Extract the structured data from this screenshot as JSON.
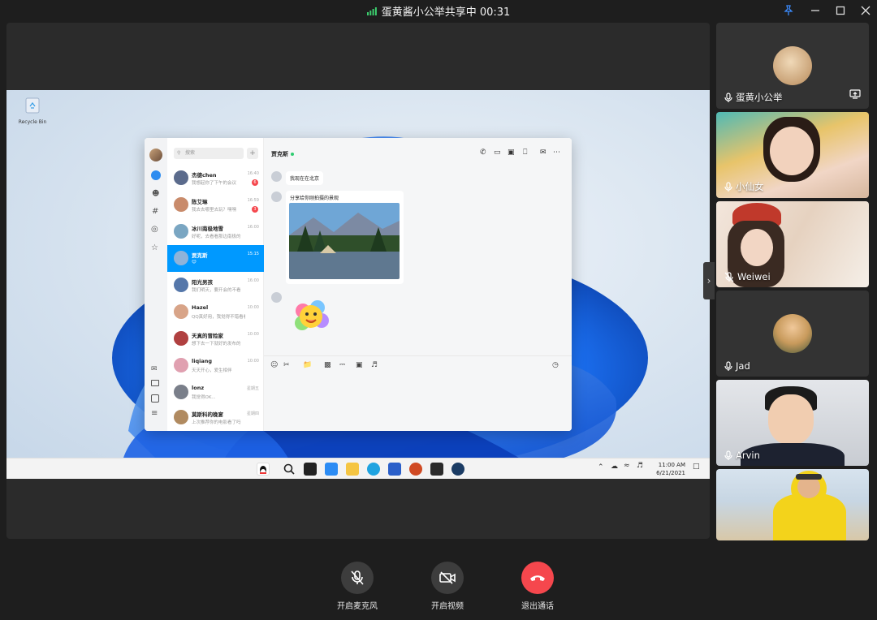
{
  "window": {
    "title": "蛋黄酱小公举共享中 00:31",
    "pin_icon": "pin-icon",
    "minimize_icon": "minimize-icon",
    "maximize_icon": "maximize-icon",
    "close_icon": "close-icon"
  },
  "shared_screen": {
    "desktop": {
      "recycle_bin_label": "Recycle Bin",
      "clock_time": "11:00 AM",
      "clock_date": "6/21/2021"
    },
    "qq": {
      "search_placeholder": "搜索",
      "add_label": "+",
      "conversations": [
        {
          "name": "杰德chen",
          "preview": "我想起你了下午的会议",
          "time": "16:40",
          "badge": "6",
          "color": "#5b6b8c"
        },
        {
          "name": "陈艾琳",
          "preview": "我去去哪里去玩？嘿嘿",
          "time": "16:59",
          "badge": "3",
          "color": "#c98b6b"
        },
        {
          "name": "冰川南极地雪",
          "preview": "好呢，去看看那边南极的",
          "time": "16:00",
          "badge": "",
          "color": "#7aa6c2"
        },
        {
          "name": "贾克斯",
          "preview": "😊",
          "time": "15:15",
          "badge": "",
          "color": "#8fb3d9"
        },
        {
          "name": "阳光男孩",
          "preview": "我们明天，要开会的不看",
          "time": "16:00",
          "badge": "",
          "color": "#5577aa"
        },
        {
          "name": "Hazel",
          "preview": "QQ真好用，我觉得不错看看",
          "time": "10:00",
          "badge": "",
          "color": "#d8a488"
        },
        {
          "name": "天真的冒险家",
          "preview": "想下去一下就好的发布的",
          "time": "10:00",
          "badge": "",
          "color": "#b04040"
        },
        {
          "name": "liqiang",
          "preview": "天天开心，爱生相伴",
          "time": "10:00",
          "badge": "",
          "color": "#e0a0b0"
        },
        {
          "name": "lonz",
          "preview": "我觉得OK...",
          "time": "星期五",
          "badge": "",
          "color": "#7a7f8a"
        },
        {
          "name": "莫斯科的晚宴",
          "preview": "上次推荐你的电影看了吗",
          "time": "星期四",
          "badge": "",
          "color": "#b08a60"
        }
      ],
      "chat": {
        "contact_name": "贾克斯",
        "messages": [
          {
            "text": "我现在在北京"
          },
          {
            "text": "分享给你刚拍摄的景观"
          }
        ]
      }
    }
  },
  "participants": [
    {
      "name": "蛋黄小公举",
      "mic": "mic-icon",
      "sharing": true
    },
    {
      "name": "小仙女",
      "mic": "mic-icon"
    },
    {
      "name": "Weiwei",
      "mic": "mic-off-icon"
    },
    {
      "name": "Jad",
      "mic": "mic-icon"
    },
    {
      "name": "Arvin",
      "mic": "mic-icon"
    },
    {
      "name": "",
      "mic": ""
    }
  ],
  "controls": {
    "mic_label": "开启麦克风",
    "video_label": "开启视频",
    "hangup_label": "退出通话",
    "hangup_color": "#f5474d"
  }
}
